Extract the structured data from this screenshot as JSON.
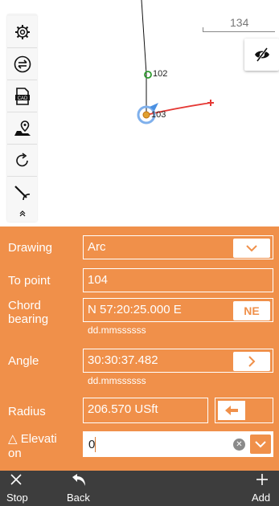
{
  "map": {
    "scale_label": "134",
    "points": [
      {
        "name": "102"
      },
      {
        "name": "103"
      }
    ]
  },
  "toolbar": {
    "items": [
      "settings-icon",
      "swap-icon",
      "cad-icon",
      "map-pin-icon",
      "refresh-icon",
      "stakeout-icon",
      "collapse-icon"
    ]
  },
  "form": {
    "drawing": {
      "label": "Drawing",
      "value": "Arc"
    },
    "to_point": {
      "label": "To point",
      "value": "104"
    },
    "chord_bearing": {
      "label": "Chord\nbearing",
      "value": "N 57:20:25.000 E",
      "button": "NE",
      "hint": "dd.mmssssss"
    },
    "angle": {
      "label": "Angle",
      "value": "30:30:37.482",
      "hint": "dd.mmssssss"
    },
    "radius": {
      "label": "Radius",
      "value": "206.570 USft"
    },
    "elevation": {
      "label": "△ Elevati\non",
      "value": "0"
    }
  },
  "bottom_bar": {
    "stop": "Stop",
    "back": "Back",
    "add": "Add"
  },
  "colors": {
    "panel": "#f0904a",
    "bottom_bar": "#3d3d3d",
    "arc": "#e53935",
    "point_green": "#2e9b2e",
    "point_selected": "#4a90e2"
  }
}
